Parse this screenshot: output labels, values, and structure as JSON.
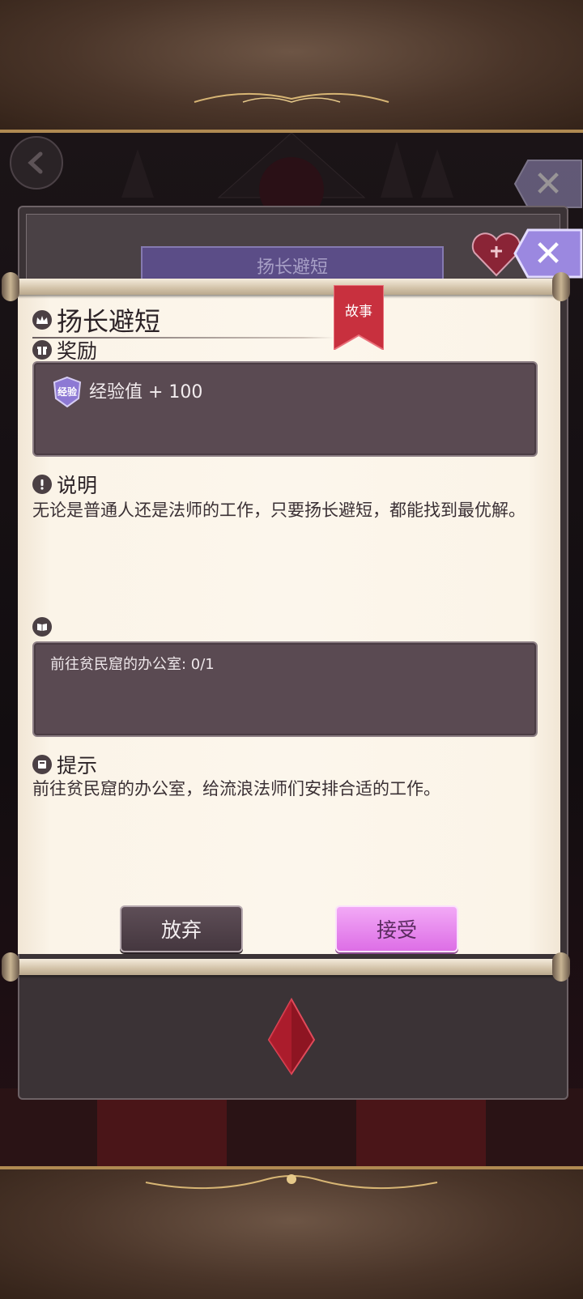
{
  "quest": {
    "title": "扬长避短",
    "tag": "故事",
    "back_panel_title": "扬长避短"
  },
  "reward": {
    "label": "奖励",
    "badge": "经验",
    "text": "经验值 + 100"
  },
  "description": {
    "label": "说明",
    "text": "无论是普通人还是法师的工作，只要扬长避短，都能找到最优解。"
  },
  "objective": {
    "text": "前往贫民窟的办公室: 0/1"
  },
  "hint": {
    "label": "提示",
    "text": "前往贫民窟的办公室，给流浪法师们安排合适的工作。"
  },
  "buttons": {
    "abandon": "放弃",
    "accept": "接受"
  },
  "colors": {
    "accent_purple": "#5b4d87",
    "accept_pink": "#e27ce9",
    "box_bg": "#5a4a52",
    "ribbon_red": "#c8303e"
  }
}
